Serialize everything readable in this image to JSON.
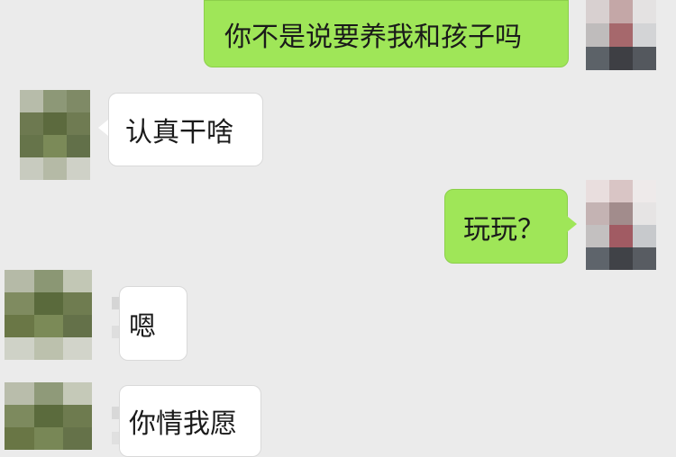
{
  "chat": {
    "messages": [
      {
        "side": "right",
        "text": "你不是说要养我和孩子吗"
      },
      {
        "side": "left",
        "text": "认真干啥"
      },
      {
        "side": "right",
        "text": "玩玩？"
      },
      {
        "side": "left",
        "text": "嗯"
      },
      {
        "side": "left",
        "text": "你情我愿"
      }
    ]
  },
  "colors": {
    "background": "#ebebeb",
    "outgoing_bubble": "#9fe658",
    "incoming_bubble": "#ffffff"
  }
}
